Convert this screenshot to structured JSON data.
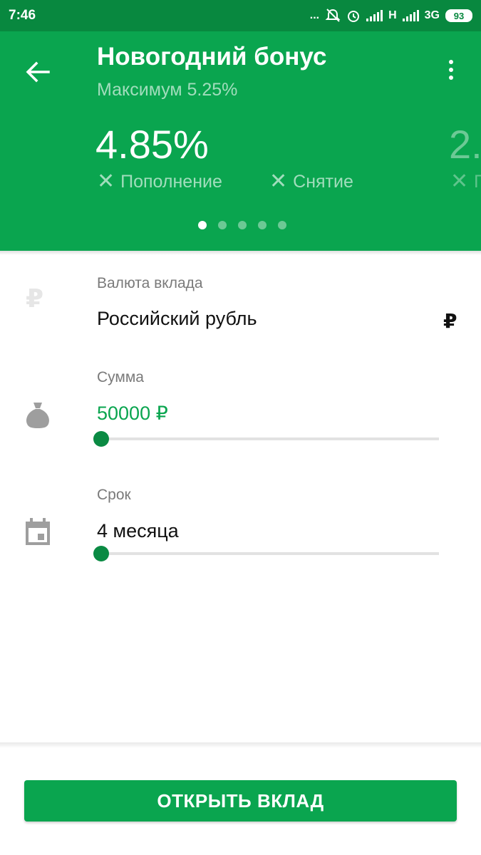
{
  "status_bar": {
    "time": "7:46",
    "dots": "...",
    "network_h": "H",
    "network_3g": "3G",
    "battery": "93"
  },
  "header": {
    "title": "Новогодний бонус",
    "subtitle": "Максимум 5.25%",
    "rate": "4.85%",
    "next_rate_peek": "2.",
    "features": [
      "Пополнение",
      "Снятие",
      "П"
    ],
    "feature_icon": "✕",
    "pager_count": 5,
    "pager_active_index": 0,
    "background_color": "#0aa54f",
    "statusbar_color": "#08883f"
  },
  "currency": {
    "label": "Валюта вклада",
    "value": "Российский рубль",
    "symbol": "₽",
    "icon": "ruble-icon"
  },
  "amount": {
    "label": "Сумма",
    "value": "50000 ₽",
    "slider_fraction": 0.0,
    "icon": "money-bag-icon",
    "accent_color": "#0aa54f"
  },
  "term": {
    "label": "Срок",
    "value": "4 месяца",
    "slider_fraction": 0.0,
    "icon": "calendar-icon"
  },
  "action": {
    "open_button_label": "ОТКРЫТЬ ВКЛАД"
  }
}
